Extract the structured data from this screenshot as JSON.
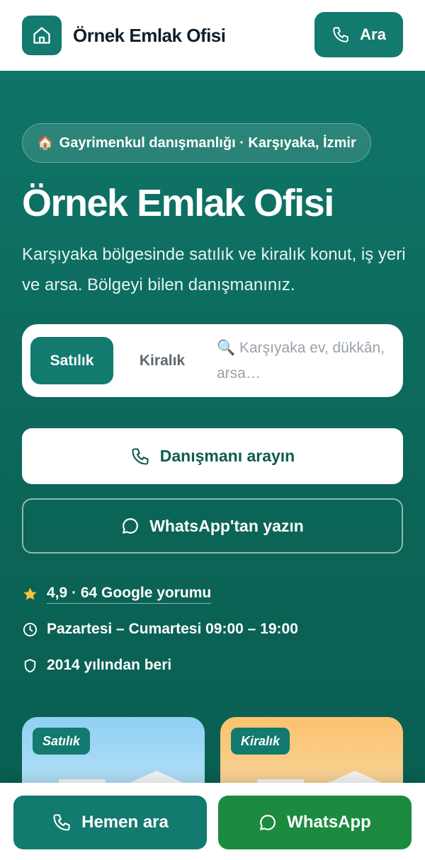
{
  "header": {
    "brand": "Örnek Emlak Ofisi",
    "call_label": "Ara",
    "logo_icon": "home-icon"
  },
  "hero": {
    "pill_emoji": "🏠",
    "pill_text": "Gayrimenkul danışmanlığı · Karşıyaka, İzmir",
    "title": "Örnek Emlak Ofisi",
    "description": "Karşıyaka bölgesinde satılık ve kiralık konut, iş yeri ve arsa. Bölgeyi bilen danışmanınız."
  },
  "search": {
    "tab_active": "Satılık",
    "tab_other": "Kiralık",
    "search_icon": "🔍",
    "placeholder": "Karşıyaka ev, dükkân, arsa…"
  },
  "actions": {
    "call_label": "Danışmanı arayın",
    "whatsapp_label": "WhatsApp'tan yazın"
  },
  "info": {
    "rating": "4,9 · 64 Google yorumu",
    "hours": "Pazartesi – Cumartesi 09:00 – 19:00",
    "since": "2014 yılından beri"
  },
  "cards": [
    {
      "badge": "Satılık"
    },
    {
      "badge": "Kiralık"
    }
  ],
  "bottom_bar": {
    "call_label": "Hemen ara",
    "whatsapp_label": "WhatsApp"
  },
  "colors": {
    "primary": "#127a6e",
    "hero_bg": "#0f7569",
    "whatsapp": "#1c8a3f",
    "star": "#f6c13b"
  }
}
